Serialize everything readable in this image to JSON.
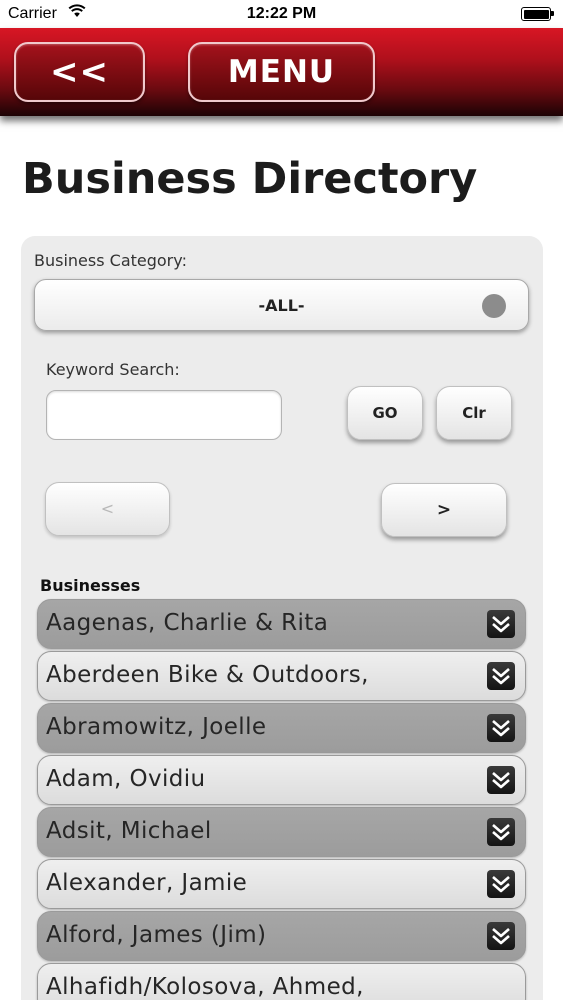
{
  "status_bar": {
    "carrier": "Carrier",
    "time": "12:22 PM",
    "wifi_icon": "wifi-icon",
    "battery_icon": "battery-icon"
  },
  "header": {
    "back_label": "<<",
    "menu_label": "MENU",
    "accent_color": "#c8101e"
  },
  "page": {
    "title": "Business Directory"
  },
  "filters": {
    "category_label": "Business Category:",
    "category_value": "-ALL-",
    "keyword_label": "Keyword Search:",
    "keyword_value": "",
    "go_label": "GO",
    "clear_label": "Clr",
    "prev_label": "<",
    "next_label": ">"
  },
  "businesses": {
    "title": "Businesses",
    "expand_icon": "chevron-down-icon",
    "items": [
      {
        "name": "Aagenas, Charlie & Rita"
      },
      {
        "name": "Aberdeen Bike & Outdoors,"
      },
      {
        "name": "Abramowitz, Joelle"
      },
      {
        "name": "Adam, Ovidiu"
      },
      {
        "name": "Adsit, Michael"
      },
      {
        "name": "Alexander, Jamie"
      },
      {
        "name": "Alford, James (Jim)"
      },
      {
        "name": "Alhafidh/Kolosova, Ahmed,"
      }
    ]
  }
}
